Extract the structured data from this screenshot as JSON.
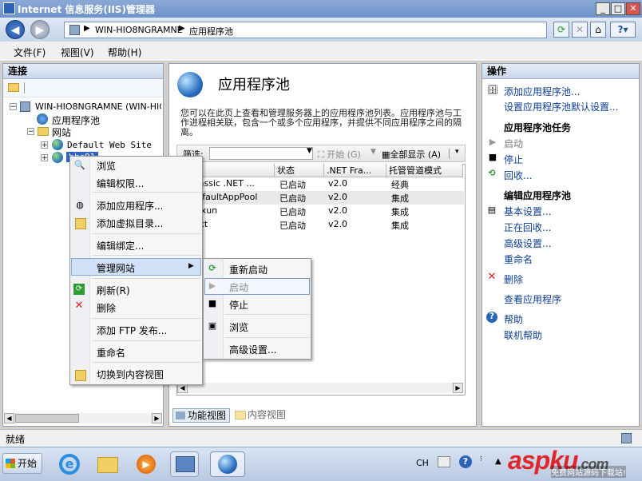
{
  "window": {
    "title": "Internet 信息服务(IIS)管理器"
  },
  "address": {
    "segments": [
      "WIN-HIO8NGRAMNE",
      "应用程序池"
    ]
  },
  "menu": {
    "file": "文件(F)",
    "view": "视图(V)",
    "help": "帮助(H)"
  },
  "left": {
    "header": "连接",
    "tree": {
      "server": "WIN-HIO8NGRAMNE (WIN-HIO8N",
      "apppools": "应用程序池",
      "sites": "网站",
      "default_site": "Default Web Site",
      "selected_site": "bbs01"
    }
  },
  "center": {
    "title": "应用程序池",
    "description": "您可以在此页上查看和管理服务器上的应用程序池列表。应用程序池与工作进程相关联，包含一个或多个应用程序，并提供不同应用程序之间的隔离。",
    "filter_label": "筛选:",
    "start_label": "开始 (G)",
    "showall_label": "全部显示 (A)",
    "columns": [
      "名称",
      "状态",
      ".NET Fra...",
      "托管管道模式"
    ],
    "rows": [
      {
        "name": "Classic .NET ...",
        "status": "已启动",
        "net": "v2.0",
        "mode": "经典"
      },
      {
        "name": "DefaultAppPool",
        "status": "已启动",
        "net": "v2.0",
        "mode": "集成"
      },
      {
        "name": "feixun",
        "status": "已启动",
        "net": "v2.0",
        "mode": "集成"
      },
      {
        "name": "Text",
        "status": "已启动",
        "net": "v2.0",
        "mode": "集成"
      }
    ],
    "tabs": {
      "features": "功能视图",
      "content": "内容视图"
    }
  },
  "right": {
    "header": "操作",
    "add_pool": "添加应用程序池...",
    "set_defaults": "设置应用程序池默认设置...",
    "tasks_header": "应用程序池任务",
    "start": "启动",
    "stop": "停止",
    "recycle": "回收...",
    "edit_header": "编辑应用程序池",
    "basic": "基本设置...",
    "recycling": "正在回收...",
    "advanced": "高级设置...",
    "rename": "重命名",
    "delete": "删除",
    "view_apps": "查看应用程序",
    "help": "帮助",
    "online_help": "联机帮助"
  },
  "context_menu": {
    "browse": "浏览",
    "edit_perms": "编辑权限...",
    "add_app": "添加应用程序...",
    "add_vdir": "添加虚拟目录...",
    "edit_bindings": "编辑绑定...",
    "manage_site": "管理网站",
    "refresh": "刷新(R)",
    "delete": "删除",
    "add_ftp": "添加 FTP 发布...",
    "rename": "重命名",
    "switch_content": "切换到内容视图"
  },
  "submenu": {
    "restart": "重新启动",
    "start": "启动",
    "stop": "停止",
    "browse": "浏览",
    "advanced": "高级设置..."
  },
  "status": {
    "text": "就绪"
  },
  "taskbar": {
    "start": "开始",
    "lang": "CH",
    "watermark": "aspku",
    "watermark_tld": ".com",
    "watermark_sub": "免费网站源码下载站!"
  },
  "colors": {
    "accent": "#2a63b8",
    "selected": "#cfe0f7",
    "delete_red": "#d42020",
    "start_green": "#2f9a2f"
  }
}
